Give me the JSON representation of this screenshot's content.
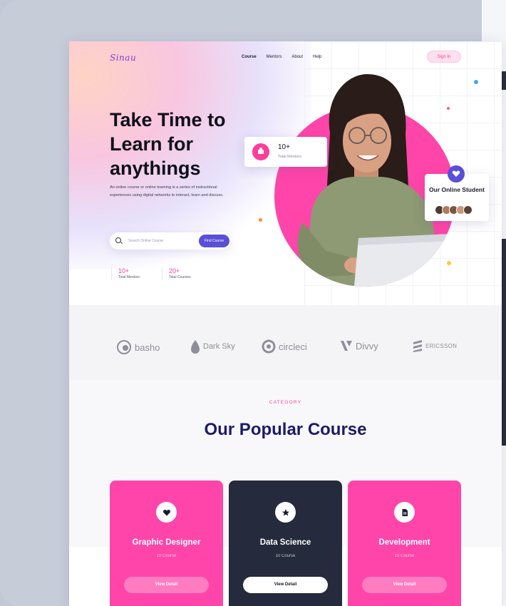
{
  "brand": {
    "logo": "Sinau"
  },
  "nav": {
    "items": [
      "Course",
      "Mentors",
      "About",
      "Help"
    ],
    "active": "Course",
    "signin": "Sign In"
  },
  "hero": {
    "headline": "Take Time to Learn for anythings",
    "description": "An online course or online learning is a series of instructional experiences using digital networks to interact, learn and discuss.",
    "search_placeholder": "Search Online Course",
    "search_button": "Find Course",
    "stats": [
      {
        "value": "10+",
        "label": "Total Mentors"
      },
      {
        "value": "20+",
        "label": "Total Courses"
      }
    ],
    "mentors_card": {
      "value": "10+",
      "label": "Total Mentors"
    },
    "student_card": {
      "title": "Our Online Student"
    }
  },
  "partners": [
    "basho",
    "Dark Sky",
    "circleci",
    "Divvy",
    "ERICSSON"
  ],
  "category": {
    "tag": "CATEGORY",
    "title": "Our Popular Course",
    "courses": [
      {
        "title": "Graphic Designer",
        "count": "10 Course",
        "button": "View Detail",
        "icon": "heart-icon"
      },
      {
        "title": "Data Science",
        "count": "10 Course",
        "button": "View Detail",
        "icon": "star-icon"
      },
      {
        "title": "Development",
        "count": "10 Course",
        "button": "View Detail",
        "icon": "document-icon"
      }
    ]
  },
  "colors": {
    "accent_pink": "#ff45a9",
    "accent_purple": "#5a4fd6",
    "dark_card": "#252a3c",
    "title_navy": "#1d1a6b"
  }
}
